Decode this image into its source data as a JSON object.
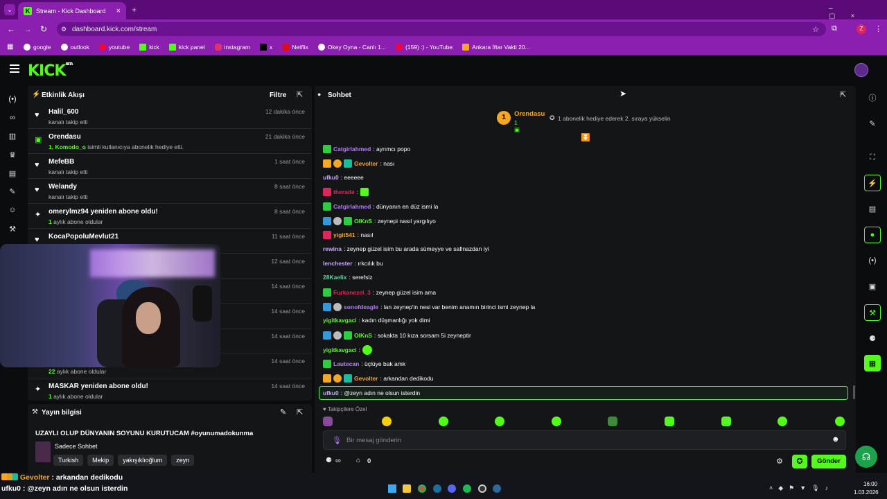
{
  "browser": {
    "tab_title": "Stream - Kick Dashboard",
    "url": "dashboard.kick.com/stream",
    "bookmarks": [
      "google",
      "outlook",
      "youtube",
      "kick",
      "kick panel",
      "instagram",
      "x",
      "Netflix",
      "Okey Oyna - Canlı 1...",
      "(159) :) - YouTube",
      "Ankara İftar Vakti 20..."
    ]
  },
  "app": {
    "logo": "KICK",
    "beta": "BETA"
  },
  "activity": {
    "title": "Etkinlik Akışı",
    "filter_label": "Filtre",
    "items": [
      {
        "name": "Halil_600",
        "sub": "kanalı takip etti",
        "time": "12 dakika önce",
        "icon": "heart-icon"
      },
      {
        "name": "Orendasu",
        "sub_bold": "1, Komodo_o",
        "sub": "isimli kullanıcıya abonelik hediye etti.",
        "time": "21 dakika önce",
        "icon": "gift-icon"
      },
      {
        "name": "MefeBB",
        "sub": "kanalı takip etti",
        "time": "1 saat önce",
        "icon": "heart-icon"
      },
      {
        "name": "Welandy",
        "sub": "kanalı takip etti",
        "time": "8 saat önce",
        "icon": "heart-icon"
      },
      {
        "name": "omerylmz94 yeniden abone oldu!",
        "sub_bold": "1",
        "sub": "aylık abone oldular",
        "time": "8 saat önce",
        "icon": "sparkle-icon"
      },
      {
        "name": "KocaPopoluMevlut21",
        "sub": "",
        "time": "11 saat önce",
        "icon": "heart-icon"
      },
      {
        "name": "",
        "sub": "",
        "time": "12 saat önce",
        "icon": ""
      },
      {
        "name": "",
        "sub": "",
        "time": "14 saat önce",
        "icon": ""
      },
      {
        "name": "",
        "sub": "",
        "time": "14 saat önce",
        "icon": ""
      },
      {
        "name": "",
        "sub": "",
        "time": "14 saat önce",
        "icon": ""
      },
      {
        "name": "",
        "sub_bold": "22",
        "sub": "aylık abone oldular",
        "time": "14 saat önce",
        "icon": ""
      },
      {
        "name": "MASKAR yeniden abone oldu!",
        "sub_bold": "1",
        "sub": "aylık abone oldular",
        "time": "14 saat önce",
        "icon": "sparkle-icon"
      }
    ]
  },
  "stream_info": {
    "title": "Yayın bilgisi",
    "stream_title": "UZAYLI OLUP DÜNYANIN SOYUNU KURUTUCAM #oyunumadokunma",
    "category": "Sadece Sohbet",
    "tags": [
      "Turkish",
      "Mekip",
      "yakışıklıoğlum",
      "zeyn"
    ]
  },
  "chat": {
    "title": "Sohbet",
    "leader_name": "Orendasu",
    "leader_rank": "1",
    "leader_count": "1",
    "gift_prompt": "1 abonelik hediye ederek 2. sıraya yükselin",
    "messages": [
      {
        "user": "Catgirlahmed",
        "color": "#b57bff",
        "text": ": ayrımcı popo",
        "badges": [
          "#2ecc40"
        ]
      },
      {
        "user": "Gevolter",
        "color": "#f5a623",
        "text": ": nası",
        "badges": [
          "#f5a623",
          "#f5a623",
          "#1abc9c"
        ]
      },
      {
        "user": "ufku0",
        "color": "#c9a6ff",
        "text": ": eeeeee",
        "badges": []
      },
      {
        "user": "therade",
        "color": "#e0245e",
        "text": ": ",
        "badges": [
          "#e0245e"
        ],
        "emote": "#53fc18"
      },
      {
        "user": "Catgirlahmed",
        "color": "#b57bff",
        "text": ": dünyanın en düz ismi la",
        "badges": [
          "#2ecc40"
        ]
      },
      {
        "user": "OIKnS",
        "color": "#53fc18",
        "text": ": zeynepi nasıl yargılıyo",
        "badges": [
          "#3498db",
          "#bbbbbb",
          "#2ecc40"
        ]
      },
      {
        "user": "yigit541",
        "color": "#f5a623",
        "text": ": nasıl",
        "badges": [
          "#e0245e"
        ]
      },
      {
        "user": "rewina",
        "color": "#c9a6ff",
        "text": ": zeynep güzel isim bu arada sümeyye ve safinazdan iyi",
        "badges": []
      },
      {
        "user": "lenchester",
        "color": "#c9a6ff",
        "text": ": ırkcılık bu",
        "badges": []
      },
      {
        "user": "28Kaelix",
        "color": "#5fd3a5",
        "text": ": serefsiz",
        "badges": []
      },
      {
        "user": "Furkanezel_3",
        "color": "#e0245e",
        "text": ": zeynep güzel isim ama",
        "badges": [
          "#2ecc40"
        ]
      },
      {
        "user": "sonofdeagle",
        "color": "#b57bff",
        "text": ": lan zeynep'in nesi var benim anamın birinci ismi zeynep la",
        "badges": [
          "#3498db",
          "#bbbbbb"
        ]
      },
      {
        "user": "yigitkavgaci",
        "color": "#53fc18",
        "text": ": kadın düşmanlığı yok dimi",
        "badges": []
      },
      {
        "user": "OIKnS",
        "color": "#53fc18",
        "text": ": sokakta 10 kıza sorsam 5i zeyneptir",
        "badges": [
          "#3498db",
          "#bbbbbb",
          "#2ecc40"
        ]
      },
      {
        "user": "yigitkavgaci",
        "color": "#53fc18",
        "text": ": ",
        "badges": [],
        "emote": "#53fc18"
      },
      {
        "user": "Lautecan",
        "color": "#b57bff",
        "text": ": üçlüye bak amk",
        "badges": [
          "#2ecc40"
        ]
      },
      {
        "user": "Gevolter",
        "color": "#f5a623",
        "text": ": arkandan dedikodu",
        "badges": [
          "#f5a623",
          "#f5a623",
          "#1abc9c"
        ]
      },
      {
        "user": "ufku0",
        "color": "#c9a6ff",
        "text": ": @zeyn adın ne olsun isterdin",
        "badges": [],
        "highlight": true
      }
    ],
    "emote_section": "Takipçilere Özel",
    "input_placeholder": "Bir mesaj gönderin",
    "points_label": "∞",
    "count": "0",
    "send_label": "Gönder"
  },
  "overlay": {
    "line1_user": "Gevolter",
    "line1_text": " : arkandan dedikodu",
    "line2_user": "ufku0",
    "line2_text": " : @zeyn adın ne olsun isterdin"
  },
  "clock": {
    "time": "16:00",
    "date": "1.03.2026"
  },
  "colors": {
    "accent": "#53fc18",
    "browser": "#8a1fb0"
  }
}
